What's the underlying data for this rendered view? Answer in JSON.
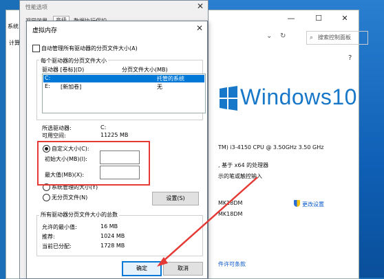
{
  "sys_window": {
    "title_left": "系统",
    "tab_left": "计算",
    "search_placeholder": "搜索控制面板",
    "windows_logo_text": "Windows10",
    "cpu_line": "TM) i3-4150 CPU @ 3.50GHz   3.50 GHz",
    "os_line": ", 基于 x64 的处理器",
    "pen_line": "示的笔或触控输入",
    "comp_name_1": "MK18DM",
    "comp_name_2": "MK18DM",
    "change_settings": "更改设置",
    "activate_link": "件许可条款"
  },
  "perf_window": {
    "title": "性能选项",
    "tab_visual": "视觉效果",
    "tab_advanced": "高级",
    "tab_dep": "数据执行保护"
  },
  "vm_dialog": {
    "title": "虚拟内存",
    "auto_manage_label": "自动管理所有驱动器的分页文件大小(A)",
    "per_drive_group": "每个驱动器的分页文件大小",
    "col_drive": "驱动器 [卷标](D)",
    "col_size": "分页文件大小(MB)",
    "drives": [
      {
        "drive": "C:",
        "label": "",
        "size": "托管的系统"
      },
      {
        "drive": "E:",
        "label": "[新加卷]",
        "size": "无"
      }
    ],
    "selected_drive_label": "所选驱动器:",
    "selected_drive_value": "C:",
    "free_space_label": "可用空间:",
    "free_space_value": "11225 MB",
    "custom_size_label": "自定义大小(C):",
    "initial_size_label": "初始大小(MB)(I):",
    "initial_size_value": "",
    "max_size_label": "最大值(MB)(X):",
    "max_size_value": "",
    "system_managed_label": "系统管理的大小(Y)",
    "no_paging_label": "无分页文件(N)",
    "set_button": "设置(S)",
    "total_group": "所有驱动器分页文件大小的总数",
    "min_allowed_label": "允许的最小值:",
    "min_allowed_value": "16 MB",
    "recommended_label": "推荐:",
    "recommended_value": "1024 MB",
    "current_label": "当前已分配:",
    "current_value": "1728 MB",
    "ok_button": "确定",
    "cancel_button": "取消"
  },
  "colors": {
    "accent": "#0078d7",
    "annotation": "#e53935",
    "windows_blue": "#1777c9"
  }
}
